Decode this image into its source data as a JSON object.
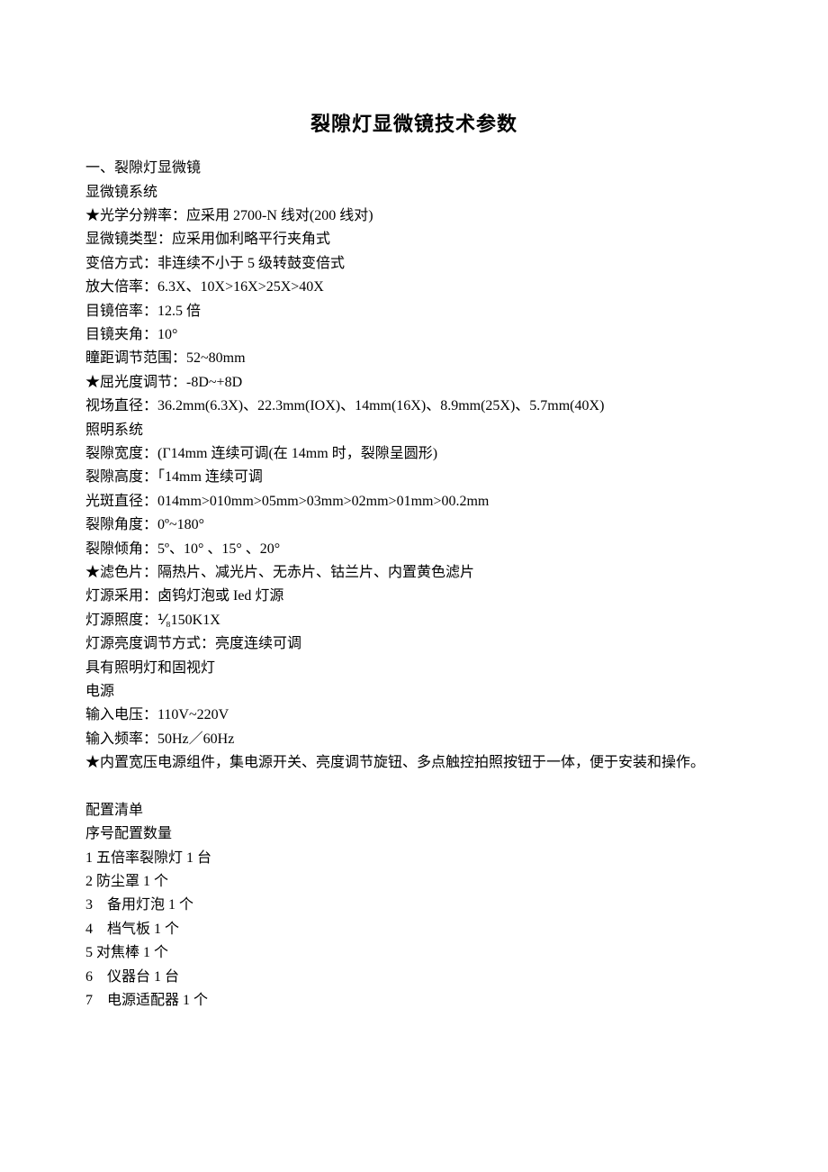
{
  "title": "裂隙灯显微镜技术参数",
  "sections": {
    "header1": "一、裂隙灯显微镜",
    "microscope_system_label": "显微镜系统",
    "optical_resolution": "★光学分辨率：应采用 2700-N 线对(200 线对)",
    "microscope_type": "显微镜类型：应采用伽利略平行夹角式",
    "zoom_method": "变倍方式：非连续不小于 5 级转鼓变倍式",
    "magnification": "放大倍率：6.3X、10X>16X>25X>40X",
    "eyepiece_mag": "目镜倍率：12.5 倍",
    "eyepiece_angle": "目镜夹角：10°",
    "pupil_dist": "瞳距调节范围：52~80mm",
    "diopter": "★屈光度调节：-8D~+8D",
    "field_diameter": "视场直径：36.2mm(6.3X)、22.3mm(IOX)、14mm(16X)、8.9mm(25X)、5.7mm(40X)",
    "illumination_label": "照明系统",
    "slit_width": "裂隙宽度：(Γ14mm 连续可调(在 14mm 时，裂隙呈圆形)",
    "slit_height": "裂隙高度：「14mm 连续可调",
    "spot_diameter": "光斑直径：014mm>010mm>05mm>03mm>02mm>01mm>00.2mm",
    "slit_angle": "裂隙角度：0º~180°",
    "slit_tilt": "裂隙倾角：5º、10° 、15° 、20°",
    "filter": "★滤色片：隔热片、减光片、无赤片、钴兰片、内置黄色滤片",
    "lamp_source": "灯源采用：卤钨灯泡或 Ied 灯源",
    "lamp_illuminance": "灯源照度：⅟₈150K1X",
    "brightness_adjust": "灯源亮度调节方式：亮度连续可调",
    "has_lights": "具有照明灯和固视灯",
    "power_label": "电源",
    "input_voltage": "输入电压：110V~220V",
    "input_freq": "输入频率：50Hz／60Hz",
    "builtin_psu": "★内置宽压电源组件，集电源开关、亮度调节旋钮、多点触控拍照按钮于一体，便于安装和操作。",
    "config_label": "配置清单",
    "config_header": "序号配置数量",
    "item1": "1 五倍率裂隙灯 1 台",
    "item2": "2 防尘罩 1 个",
    "item3": "3    备用灯泡 1 个",
    "item4": "4    档气板 1 个",
    "item5": "5 对焦棒 1 个",
    "item6": "6    仪器台 1 台",
    "item7": "7    电源适配器 1 个"
  }
}
